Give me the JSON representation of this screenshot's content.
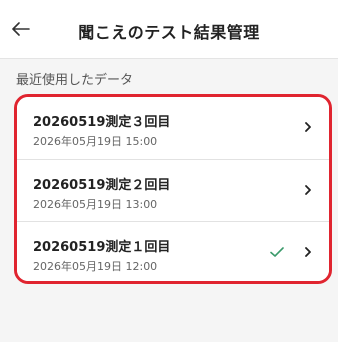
{
  "header": {
    "title": "聞こえのテスト結果管理"
  },
  "section": {
    "title": "最近使用したデータ"
  },
  "items": [
    {
      "title": "20260519測定３回目",
      "date": "2026年05月19日 15:00",
      "checked": false
    },
    {
      "title": "20260519測定２回目",
      "date": "2026年05月19日 13:00",
      "checked": false
    },
    {
      "title": "20260519測定１回目",
      "date": "2026年05月19日 12:00",
      "checked": true
    }
  ],
  "colors": {
    "highlight": "#e0242f",
    "check": "#3a9a6a"
  }
}
